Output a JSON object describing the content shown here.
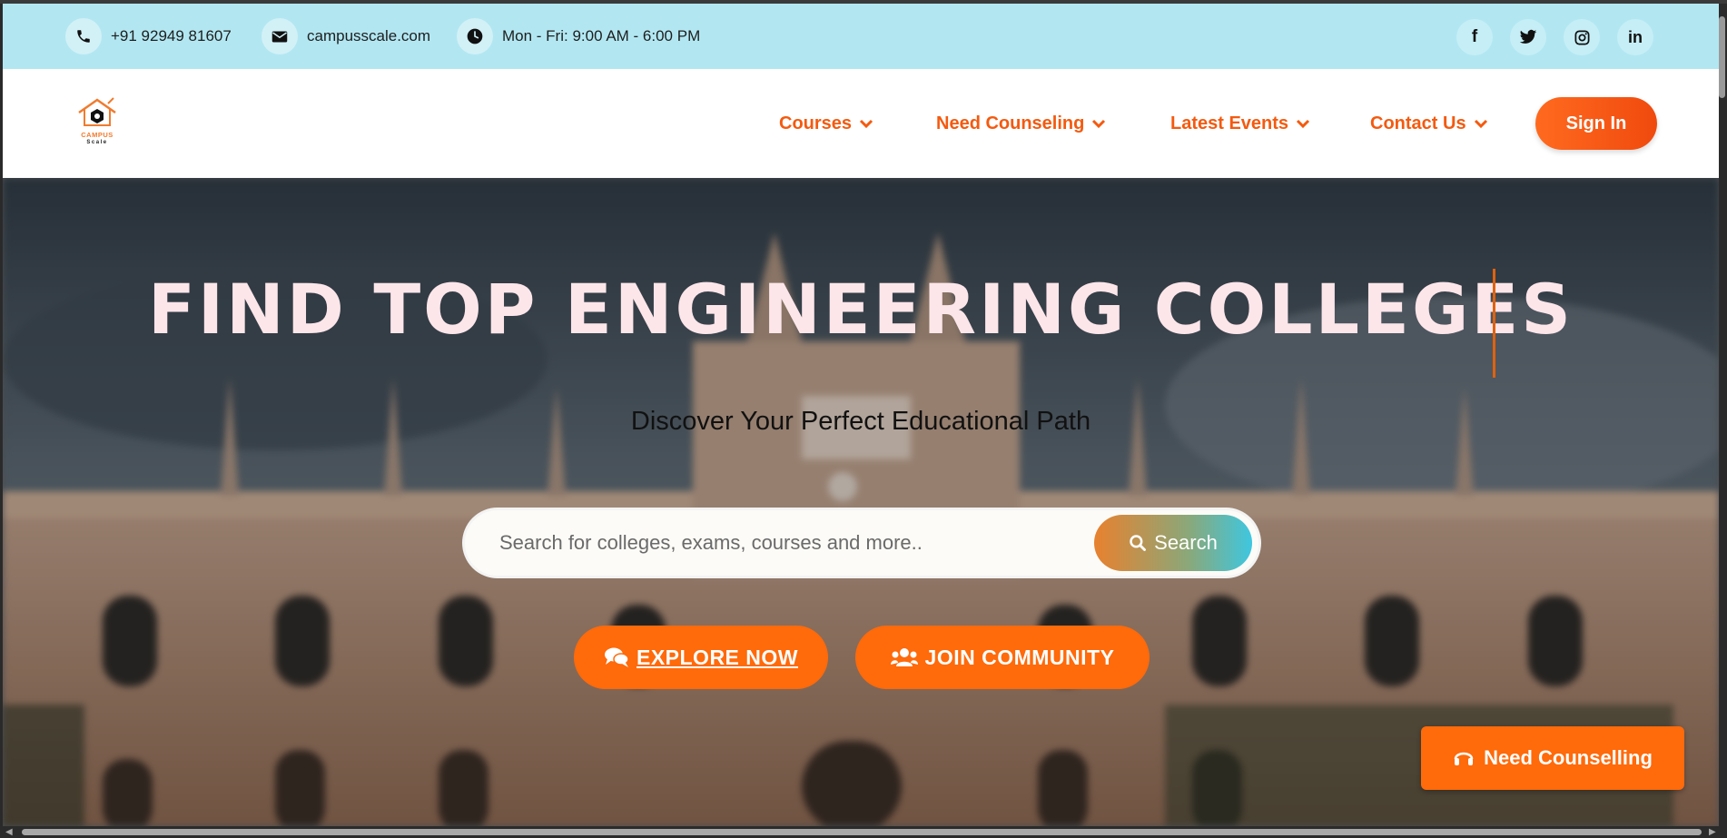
{
  "topbar": {
    "phone": "+91 92949 81607",
    "email": "campusscale.com",
    "hours": "Mon - Fri: 9:00 AM - 6:00 PM",
    "social": [
      "facebook-icon",
      "twitter-icon",
      "instagram-icon",
      "linkedin-icon"
    ]
  },
  "brand": {
    "name": "CAMPUS",
    "tagline": "Scale"
  },
  "nav": {
    "items": [
      {
        "label": "Courses"
      },
      {
        "label": "Need Counseling"
      },
      {
        "label": "Latest Events"
      },
      {
        "label": "Contact Us"
      }
    ],
    "signin_label": "Sign In"
  },
  "hero": {
    "title": "FIND TOP ENGINEERING COLLEGES",
    "subtitle": "Discover Your Perfect Educational Path",
    "search_placeholder": "Search for colleges, exams, courses and more..",
    "search_label": "Search",
    "explore_label": "EXPLORE NOW",
    "join_label": "JOIN COMMUNITY"
  },
  "floating": {
    "counselling_label": "Need Counselling"
  },
  "colors": {
    "accent": "#ff6a0a",
    "nav_text": "#f45a0f",
    "topbar_bg": "#b2e7f2",
    "title": "#fde6ea"
  }
}
